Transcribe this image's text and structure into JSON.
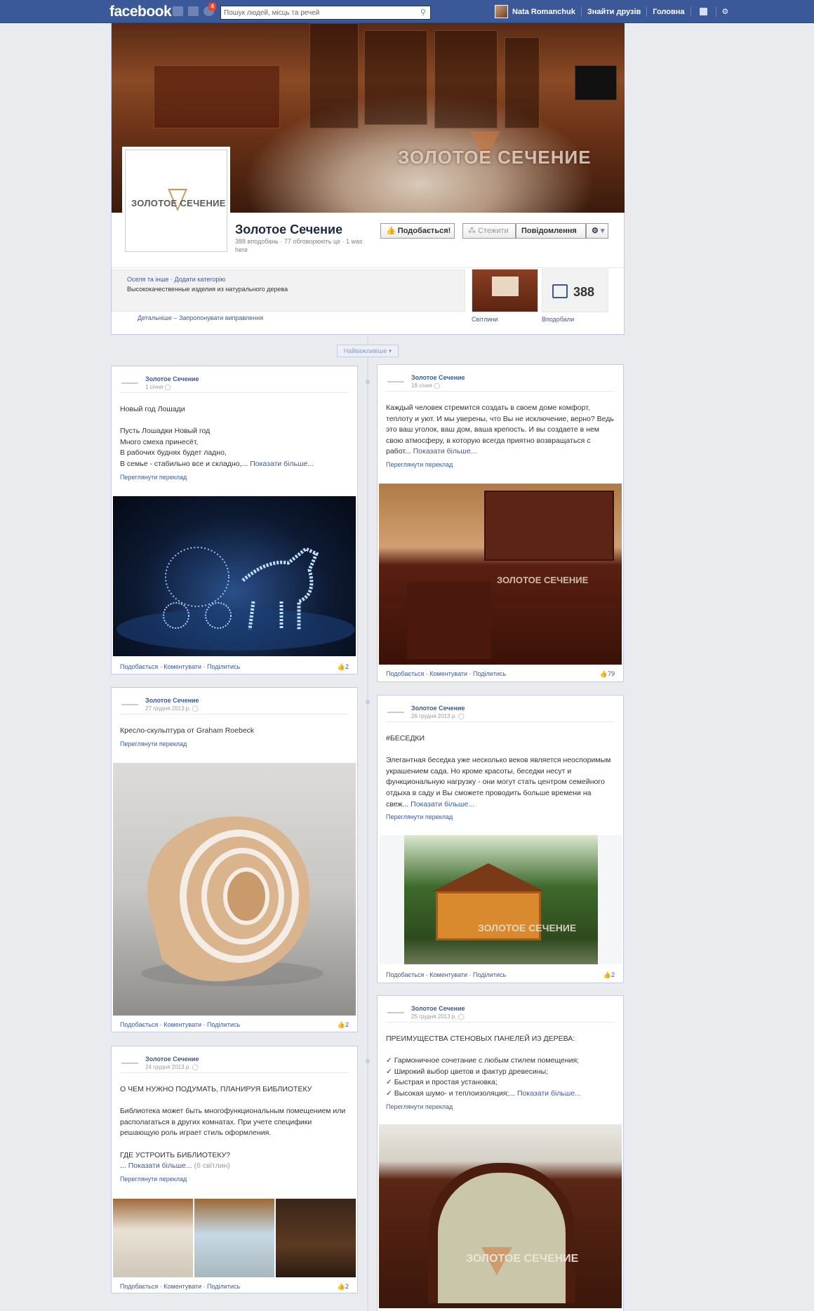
{
  "topbar": {
    "logo": "facebook",
    "notif_count": "4",
    "search_placeholder": "Пошук людей, місць та речей",
    "user_name": "Nata Romanchuk",
    "find_friends": "Знайти друзів",
    "home": "Головна"
  },
  "page": {
    "cover_text": "ЗОЛОТОЕ СЕЧЕНИЕ",
    "logo_text": "ЗОЛОТОЕ СЕЧЕНИЕ",
    "name": "Золотое Сечение",
    "meta": "388 вподобань · 77 обговорюють це · 1 was here",
    "like_button": "Подобається!",
    "follow_button": "Стежити",
    "message_button": "Повідомлення",
    "category_link": "Оселя та інше · Додати категорію",
    "description": "Высококачественные изделия из натурального дерева",
    "details_link": "Детальніше – Запропонувати виправлення",
    "photos_label": "Світлини",
    "likes_label": "Вподобали",
    "likes_count": "388"
  },
  "timeline": {
    "highlights": "Найважливіше"
  },
  "posts": [
    {
      "author": "Золотое Сечение",
      "date": "1 січня",
      "text": "Новый год Лошади\n\nПусть Лошадки Новый год\nМного смеха принесёт,\nВ рабочих буднях будет ладно,\nВ семье - стабильно все и складно,...",
      "more": "Показати більше...",
      "translate": "Переглянути переклад",
      "actions": "Подобається · Коментувати · Поділитись",
      "likes": "2"
    },
    {
      "author": "Золотое Сечение",
      "date": "18 січня",
      "text": "Каждый человек стремится создать в своем доме комфорт, теплоту и уют. И мы уверены, что Вы не исключение, верно? Ведь это ваш уголок, ваш дом, ваша крепость. И вы создаете в нем свою атмосферу, в которую всегда приятно возвращаться с работ...",
      "more": "Показати більше...",
      "translate": "Переглянути переклад",
      "actions": "Подобається · Коментувати · Поділитись",
      "likes": "79",
      "img_text": "ЗОЛОТОЕ СЕЧЕНИЕ"
    },
    {
      "author": "Золотое Сечение",
      "date": "27 грудня 2013 р.",
      "text": "Кресло-скульптура от Graham Roebeck",
      "translate": "Переглянути переклад",
      "actions": "Подобається · Коментувати · Поділитись",
      "likes": "2"
    },
    {
      "author": "Золотое Сечение",
      "date": "26 грудня 2013 р.",
      "text": "#БЕСЕДКИ\n\nЭлегантная беседка уже несколько веков является неоспоримым украшением сада. Но кроме красоты, беседки несут и функциональную нагрузку - они могут стать центром семейного отдыха в саду и Вы сможете проводить больше времени на свеж...",
      "more": "Показати більше...",
      "translate": "Переглянути переклад",
      "actions": "Подобається · Коментувати · Поділитись",
      "likes": "2",
      "img_text": "ЗОЛОТОЕ СЕЧЕНИЕ"
    },
    {
      "author": "Золотое Сечение",
      "date": "24 грудня 2013 р.",
      "text": "О ЧЕМ НУЖНО ПОДУМАТЬ, ПЛАНИРУЯ БИБЛИОТЕКУ\n\nБиблиотека может быть многофункциональным помещением или располагаться в других комнатах. При учете специфики решающую роль играет стиль оформления.\n\nГДЕ УСТРОИТЬ БИБЛИОТЕКУ?\n...",
      "more": "Показати більше...",
      "extra": "(6 світлин)",
      "translate": "Переглянути переклад",
      "actions": "Подобається · Коментувати · Поділитись",
      "likes": "2"
    },
    {
      "author": "Золотое Сечение",
      "date": "25 грудня 2013 р.",
      "text": "ПРЕИМУЩЕСТВА СТЕНОВЫХ ПАНЕЛЕЙ ИЗ ДЕРЕВА:\n\n✓ Гармоничное сочетание с любым стилем помещения;\n✓ Широкий выбор цветов и фактур древесины;\n✓ Быстрая и простая установка;\n✓ Высокая шумо- и теплоизоляция;...",
      "more": "Показати більше...",
      "translate": "Переглянути переклад",
      "img_text": "ЗОЛОТОЕ СЕЧЕНИЕ"
    }
  ]
}
